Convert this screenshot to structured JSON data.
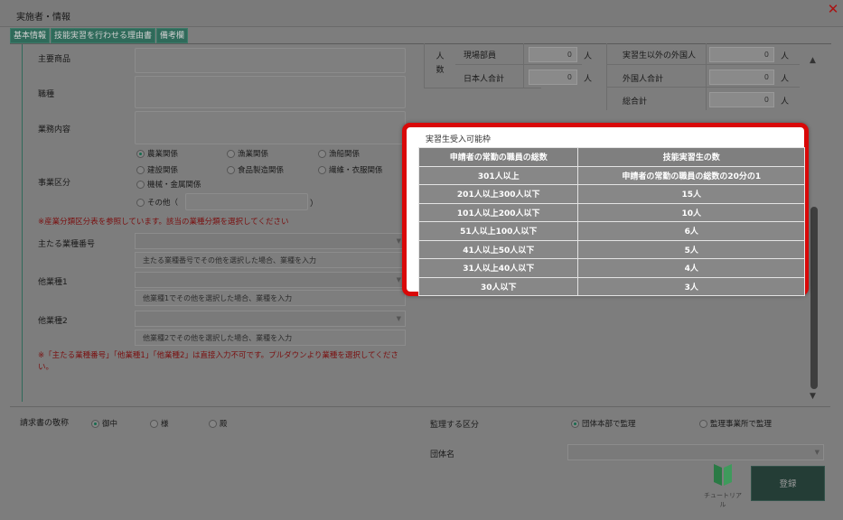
{
  "window": {
    "title": "実施者・情報",
    "close_glyph": "✕"
  },
  "tabs": [
    "基本情報",
    "技能実習を行わせる理由書",
    "備考欄"
  ],
  "form": {
    "main_products_label": "主要商品",
    "occupation_label": "職種",
    "business_label": "業務内容",
    "business_category_label": "事業区分",
    "categories": [
      {
        "label": "農業関係",
        "checked": true
      },
      {
        "label": "漁業関係",
        "checked": false
      },
      {
        "label": "漁船関係",
        "checked": false
      },
      {
        "label": "建設関係",
        "checked": false
      },
      {
        "label": "食品製造関係",
        "checked": false
      },
      {
        "label": "繊維・衣服関係",
        "checked": false
      },
      {
        "label": "機械・金属関係",
        "checked": false
      }
    ],
    "other_label": "その他（",
    "other_close": "）",
    "category_note": "※産業分類区分表を参照しています。該当の業種分類を選択してください",
    "main_industry_label": "主たる業種番号",
    "main_industry_hint": "主たる業種番号でその他を選択した場合、業種を入力",
    "other_industry1_label": "他業種1",
    "other_industry1_hint": "他業種1でその他を選択した場合、業種を入力",
    "other_industry2_label": "他業種2",
    "other_industry2_hint": "他業種2でその他を選択した場合、業種を入力",
    "input_warning": "※「主たる業種番号」「他業種1」「他業種2」は直接入力不可です。プルダウンより業種を選択してください。"
  },
  "stats": {
    "side_label": "人数",
    "rows": [
      {
        "left_label": "現場部員",
        "left_value": "0",
        "right_label": "実習生以外の外国人",
        "right_value": "0"
      },
      {
        "left_label": "日本人合計",
        "left_value": "0",
        "right_label": "外国人合計",
        "right_value": "0"
      },
      {
        "left_label": "",
        "left_value": "",
        "right_label": "総合計",
        "right_value": "0"
      }
    ],
    "unit": "人"
  },
  "billing": {
    "honorific_label": "請求書の敬称",
    "honorifics": [
      {
        "label": "御中",
        "checked": true
      },
      {
        "label": "様",
        "checked": false
      },
      {
        "label": "殿",
        "checked": false
      }
    ],
    "supervision_label": "監理する区分",
    "supervision_options": [
      {
        "label": "団体本部で監理",
        "checked": true
      },
      {
        "label": "監理事業所で監理",
        "checked": false
      }
    ],
    "group_label": "団体名"
  },
  "actions": {
    "tutorial_label": "チュートリアル",
    "register_label": "登録"
  },
  "popup": {
    "title": "実習生受入可能枠",
    "headers": [
      "申請者の常勤の職員の総数",
      "技能実習生の数"
    ],
    "rows": [
      [
        "301人以上",
        "申請者の常勤の職員の総数の20分の1"
      ],
      [
        "201人以上300人以下",
        "15人"
      ],
      [
        "101人以上200人以下",
        "10人"
      ],
      [
        "51人以上100人以下",
        "6人"
      ],
      [
        "41人以上50人以下",
        "5人"
      ],
      [
        "31人以上40人以下",
        "4人"
      ],
      [
        "30人以下",
        "3人"
      ]
    ]
  },
  "colors": {
    "highlight": "#d90808",
    "tab": "#2f6a5a",
    "warning": "#7a1010"
  }
}
